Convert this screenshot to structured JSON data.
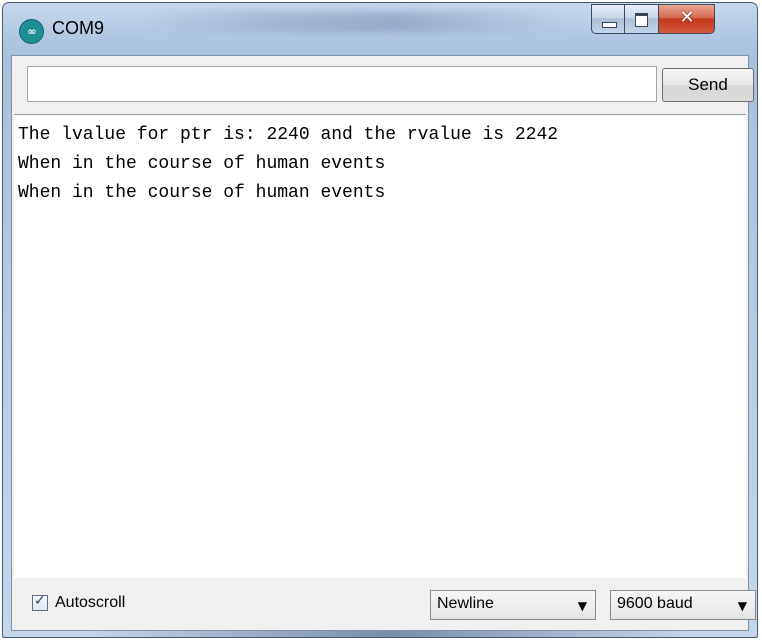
{
  "window": {
    "title": "COM9",
    "app_icon": "arduino-icon",
    "icon_glyph": "∞",
    "controls": {
      "minimize_icon": "minimize-icon",
      "maximize_icon": "maximize-icon",
      "close_icon": "close-icon",
      "close_glyph": "✕"
    }
  },
  "send_bar": {
    "input_value": "",
    "send_label": "Send"
  },
  "output": {
    "lines": [
      "The lvalue for ptr is: 2240 and the rvalue is 2242",
      "When in the course of human events",
      "When in the course of human events"
    ]
  },
  "status_bar": {
    "autoscroll_checked": true,
    "check_glyph": "✓",
    "autoscroll_label": "Autoscroll",
    "line_ending": "Newline",
    "baud_rate": "9600 baud",
    "dropdown_icon": "chevron-down-icon",
    "dropdown_glyph": "▼"
  },
  "colors": {
    "close_button": "#c4381b",
    "title_bar": "#b3c9e2",
    "icon_teal": "#1f8f96"
  }
}
